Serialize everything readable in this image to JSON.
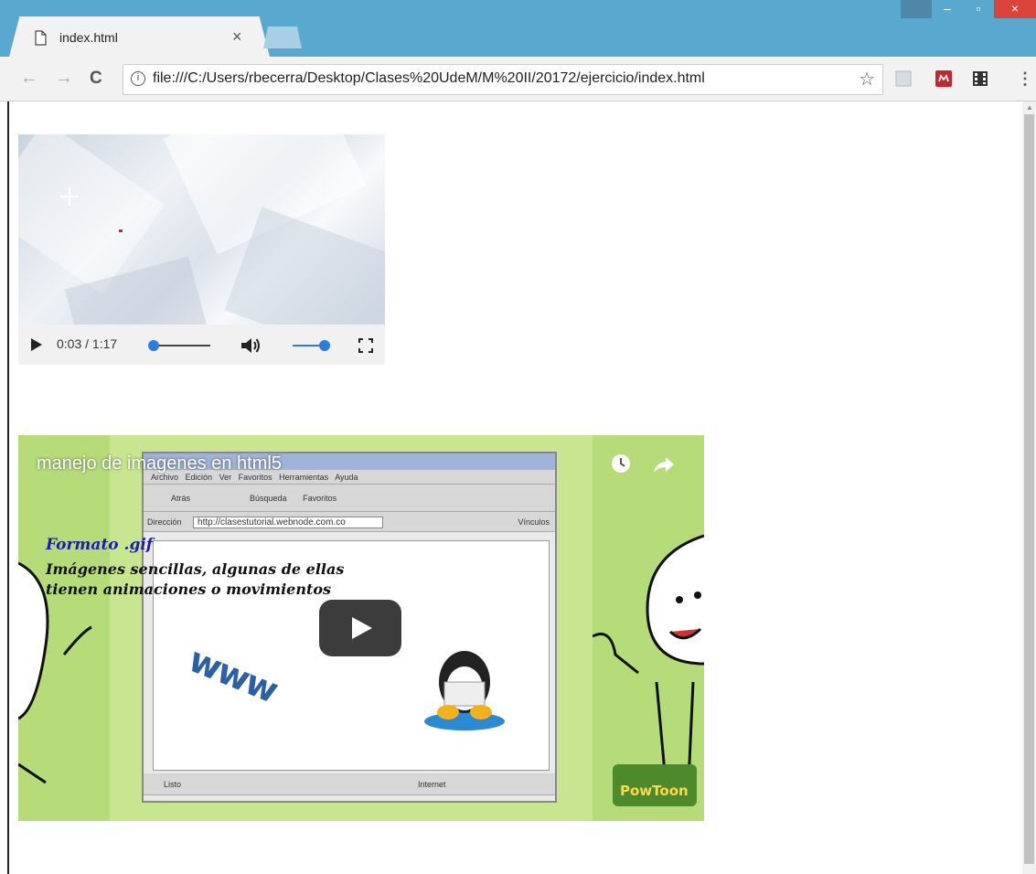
{
  "browser": {
    "tab_title": "index.html",
    "tab_close": "×",
    "url": "file:///C:/Users/rbecerra/Desktop/Clases%20UdeM/M%20II/20172/ejercicio/index.html",
    "back": "←",
    "forward": "→",
    "reload": "C",
    "info": "i",
    "bookmark_star": "☆",
    "menu": "⋮"
  },
  "video_player": {
    "time": "0:03 / 1:17",
    "progress_fraction": 0.04,
    "volume_fraction": 1.0,
    "icons": [
      "play-icon",
      "volume-icon",
      "fullscreen-icon"
    ]
  },
  "youtube_embed": {
    "title": "manejo de imagenes en html5",
    "icons": [
      "watch-later-icon",
      "share-icon",
      "play-button-icon"
    ],
    "thumbnail": {
      "format_title": "Formato .gif",
      "description": "Imágenes sencillas, algunas de ellas tienen animaciones o movimientos",
      "address_label": "Dirección",
      "address_url": "http://clasestutorial.webnode.com.co",
      "menu_items": [
        "Archivo",
        "Edición",
        "Ver",
        "Favoritos",
        "Herramientas",
        "Ayuda"
      ],
      "toolbar_items": [
        "Atrás",
        "Búsqueda",
        "Favoritos"
      ],
      "links_label": "Vínculos",
      "status_left": "Listo",
      "status_right": "Internet",
      "www_text": "www",
      "badge": "PowToon"
    }
  },
  "colors": {
    "titlebar": "#59a8cf",
    "accent_blue": "#2d7be5",
    "yt_background": "#c7e68f"
  }
}
